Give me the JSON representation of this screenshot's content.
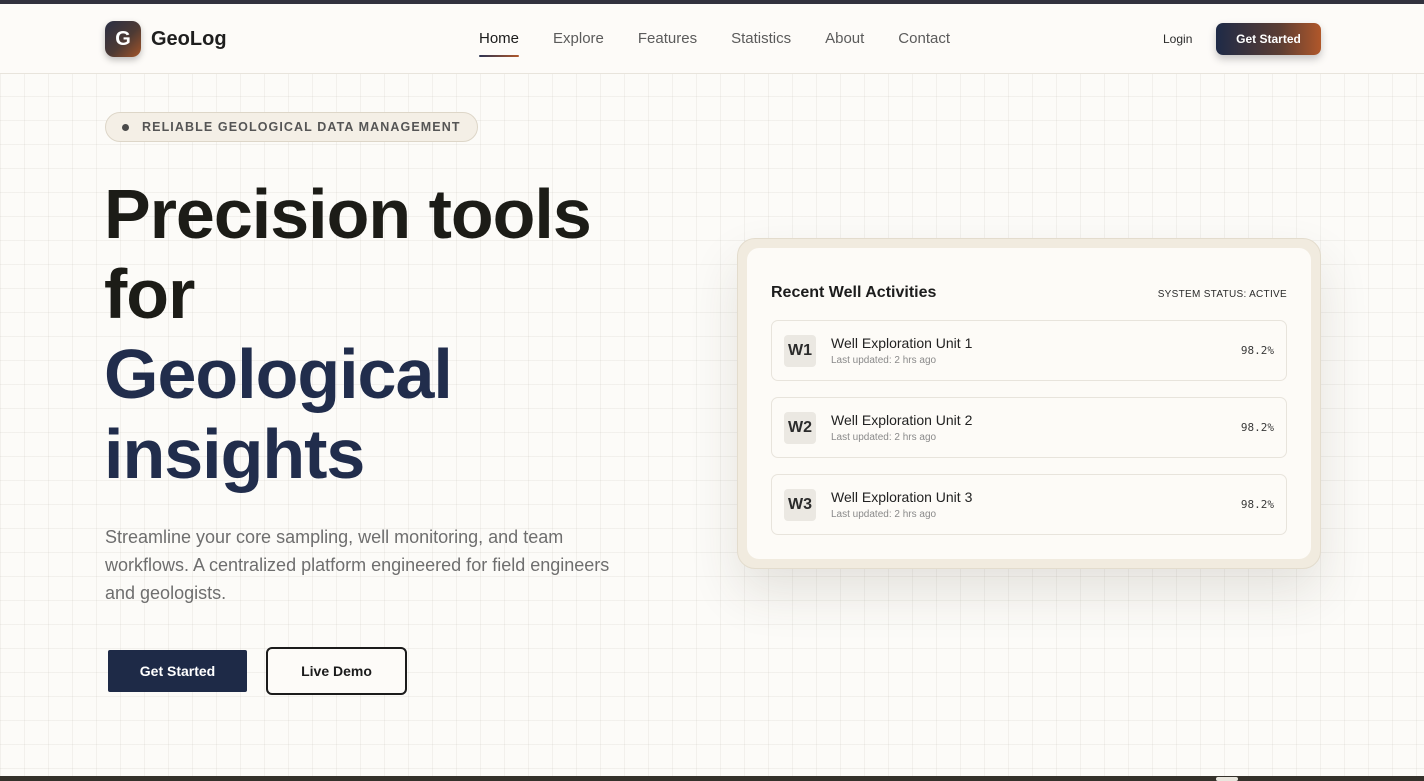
{
  "brand": {
    "logo_letter": "G",
    "name": "GeoLog"
  },
  "nav": {
    "items": [
      "Home",
      "Explore",
      "Features",
      "Statistics",
      "About",
      "Contact"
    ],
    "active": "Home"
  },
  "header": {
    "login_label": "Login",
    "cta_label": "Get Started"
  },
  "hero": {
    "badge": "RELIABLE GEOLOGICAL DATA MANAGEMENT",
    "title_line1": "Precision tools",
    "title_line2": "for",
    "title_accent_line1": "Geological",
    "title_accent_line2": "insights",
    "subtitle": "Streamline your core sampling, well monitoring, and team workflows. A centralized platform engineered for field engineers and geologists.",
    "primary_button": "Get Started",
    "secondary_button": "Live Demo"
  },
  "panel": {
    "title": "Recent Well Activities",
    "status": "SYSTEM STATUS: ACTIVE",
    "wells": [
      {
        "code": "W1",
        "name": "Well Exploration Unit 1",
        "updated": "Last updated: 2 hrs ago",
        "percent": "98.2%"
      },
      {
        "code": "W2",
        "name": "Well Exploration Unit 2",
        "updated": "Last updated: 2 hrs ago",
        "percent": "98.2%"
      },
      {
        "code": "W3",
        "name": "Well Exploration Unit 3",
        "updated": "Last updated: 2 hrs ago",
        "percent": "98.2%"
      }
    ]
  },
  "colors": {
    "navy": "#1e2a47",
    "accent_copper": "#b0572a",
    "background": "#fcfbf8",
    "panel_frame": "#f1ebdf"
  }
}
